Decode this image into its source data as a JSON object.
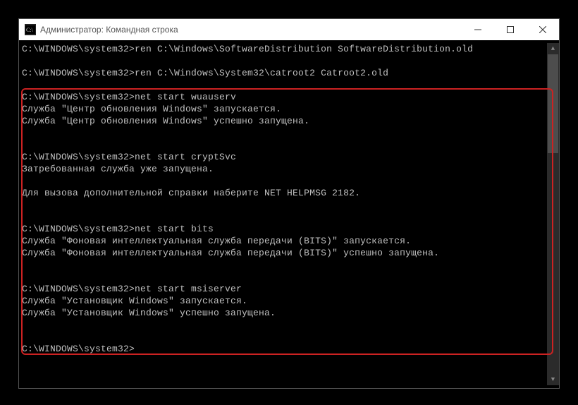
{
  "window": {
    "title": "Администратор: Командная строка"
  },
  "terminal": {
    "lines": [
      "C:\\WINDOWS\\system32>ren C:\\Windows\\SoftwareDistribution SoftwareDistribution.old",
      "",
      "C:\\WINDOWS\\system32>ren C:\\Windows\\System32\\catroot2 Catroot2.old",
      "",
      "C:\\WINDOWS\\system32>net start wuauserv",
      "Служба \"Центр обновления Windows\" запускается.",
      "Служба \"Центр обновления Windows\" успешно запущена.",
      "",
      "",
      "C:\\WINDOWS\\system32>net start cryptSvc",
      "Затребованная служба уже запущена.",
      "",
      "Для вызова дополнительной справки наберите NET HELPMSG 2182.",
      "",
      "",
      "C:\\WINDOWS\\system32>net start bits",
      "Служба \"Фоновая интеллектуальная служба передачи (BITS)\" запускается.",
      "Служба \"Фоновая интеллектуальная служба передачи (BITS)\" успешно запущена.",
      "",
      "",
      "C:\\WINDOWS\\system32>net start msiserver",
      "Служба \"Установщик Windows\" запускается.",
      "Служба \"Установщик Windows\" успешно запущена.",
      "",
      "",
      "C:\\WINDOWS\\system32>"
    ]
  }
}
